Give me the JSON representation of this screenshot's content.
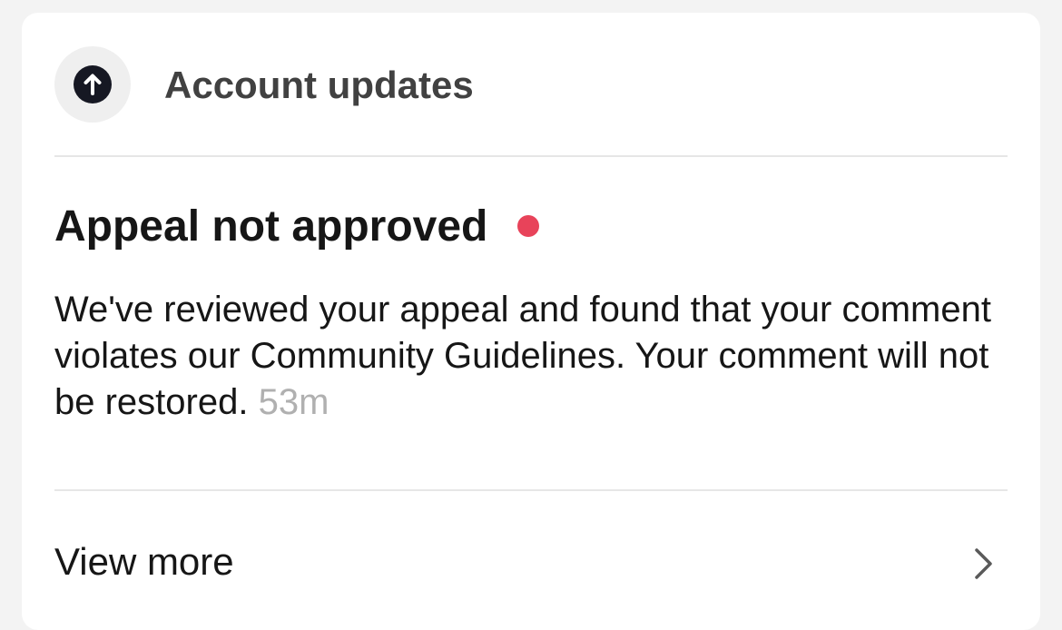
{
  "header": {
    "title": "Account updates",
    "icon": "arrow-up-circle-icon"
  },
  "notice": {
    "title": "Appeal not approved",
    "unread_dot_color": "#e8435a",
    "message": "We've reviewed your appeal and found that your comment violates our Community Guidelines. Your comment will not be restored.",
    "time": "53m"
  },
  "view_more": {
    "label": "View more",
    "icon": "chevron-right-icon"
  },
  "colors": {
    "background": "#f3f3f3",
    "card": "#ffffff",
    "icon_dark": "#161823",
    "timestamp": "#b0b0b0"
  }
}
